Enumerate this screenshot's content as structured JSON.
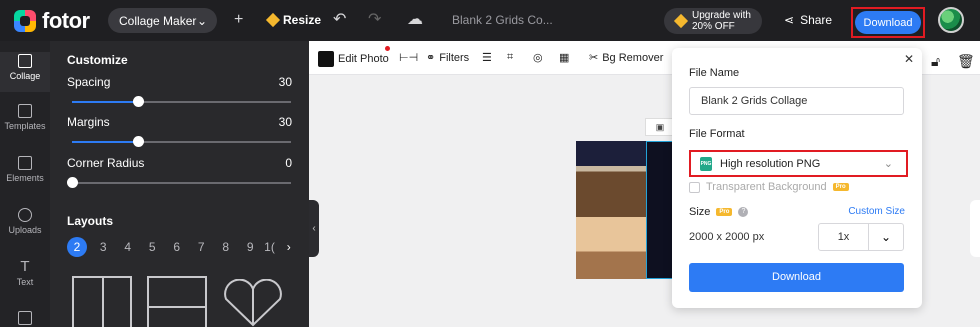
{
  "header": {
    "logo_text": "fotor",
    "mode_label": "Collage Maker",
    "resize_label": "Resize",
    "doc_name": "Blank 2 Grids Co...",
    "upgrade_line1": "Upgrade with",
    "upgrade_line2": "20% OFF",
    "share_label": "Share",
    "download_label": "Download"
  },
  "rail": {
    "items": [
      {
        "label": "Collage"
      },
      {
        "label": "Templates"
      },
      {
        "label": "Elements"
      },
      {
        "label": "Uploads"
      },
      {
        "label": "Text"
      }
    ]
  },
  "customize": {
    "title": "Customize",
    "spacing_label": "Spacing",
    "spacing_value": "30",
    "spacing_fraction": 0.3,
    "margins_label": "Margins",
    "margins_value": "30",
    "margins_fraction": 0.3,
    "radius_label": "Corner Radius",
    "radius_value": "0",
    "radius_fraction": 0,
    "layouts_title": "Layouts",
    "pages": [
      "2",
      "3",
      "4",
      "5",
      "6",
      "7",
      "8",
      "9",
      "1("
    ]
  },
  "toolbar": {
    "edit_photo": "Edit Photo",
    "filters": "Filters",
    "bg_remover": "Bg Remover"
  },
  "download_panel": {
    "file_name_label": "File Name",
    "file_name_value": "Blank 2 Grids Collage",
    "file_format_label": "File Format",
    "format_value": "High resolution PNG",
    "format_icon_text": "PNG",
    "transparent_label": "Transparent Background",
    "pro_badge": "Pro",
    "size_label": "Size",
    "custom_size": "Custom Size",
    "dimensions": "2000 x 2000 px",
    "scale": "1x",
    "button_label": "Download"
  },
  "colors": {
    "accent": "#2d7bf4",
    "highlight": "#e11b22",
    "pro": "#f5b82e"
  }
}
